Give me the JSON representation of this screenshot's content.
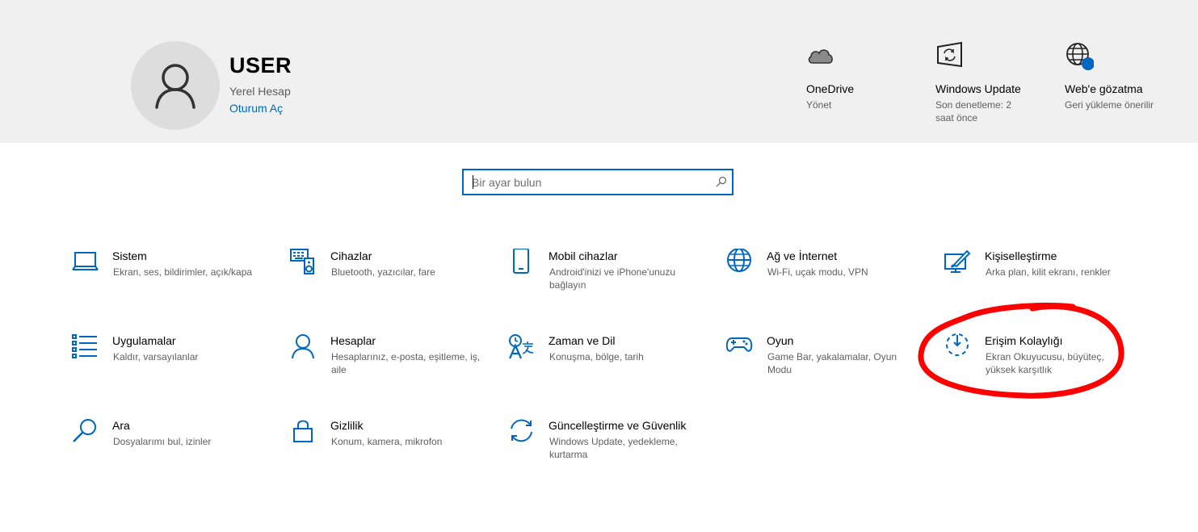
{
  "user": {
    "name": "USER",
    "account_type": "Yerel Hesap",
    "sign_in": "Oturum Aç"
  },
  "quick_links": [
    {
      "icon": "onedrive-cloud-icon",
      "title": "OneDrive",
      "subtitle": "Yönet"
    },
    {
      "icon": "windows-update-icon",
      "title": "Windows Update",
      "subtitle": "Son denetleme: 2 saat önce"
    },
    {
      "icon": "globe-icon",
      "title": "Web'e gözatma",
      "subtitle": "Geri yükleme önerilir"
    }
  ],
  "search": {
    "placeholder": "Bir ayar bulun"
  },
  "categories": [
    {
      "icon": "laptop-icon",
      "title": "Sistem",
      "desc": "Ekran, ses, bildirimler, açık/kapa"
    },
    {
      "icon": "keyboard-speaker-icon",
      "title": "Cihazlar",
      "desc": "Bluetooth, yazıcılar, fare"
    },
    {
      "icon": "phone-icon",
      "title": "Mobil cihazlar",
      "desc": "Android'inizi ve iPhone'unuzu bağlayın"
    },
    {
      "icon": "globe-icon",
      "title": "Ağ ve İnternet",
      "desc": "Wi-Fi, uçak modu, VPN"
    },
    {
      "icon": "paint-brush-icon",
      "title": "Kişiselleştirme",
      "desc": "Arka plan, kilit ekranı, renkler"
    },
    {
      "icon": "apps-list-icon",
      "title": "Uygulamalar",
      "desc": "Kaldır, varsayılanlar"
    },
    {
      "icon": "person-icon",
      "title": "Hesaplar",
      "desc": "Hesaplarınız, e-posta, eşitleme, iş, aile"
    },
    {
      "icon": "language-icon",
      "title": "Zaman ve Dil",
      "desc": "Konuşma, bölge, tarih"
    },
    {
      "icon": "game-controller-icon",
      "title": "Oyun",
      "desc": "Game Bar, yakalamalar, Oyun Modu"
    },
    {
      "icon": "ease-of-access-icon",
      "title": "Erişim Kolaylığı",
      "desc": "Ekran Okuyucusu, büyüteç, yüksek karşıtlık"
    },
    {
      "icon": "search-icon",
      "title": "Ara",
      "desc": "Dosyalarımı bul, izinler"
    },
    {
      "icon": "lock-icon",
      "title": "Gizlilik",
      "desc": "Konum, kamera, mikrofon"
    },
    {
      "icon": "sync-arrows-icon",
      "title": "Güncelleştirme ve Güvenlik",
      "desc": "Windows Update, yedekleme, kurtarma"
    }
  ],
  "colors": {
    "accent": "#0067c0",
    "header_bg": "#f0f0f0",
    "annotation": "#ff0000"
  }
}
